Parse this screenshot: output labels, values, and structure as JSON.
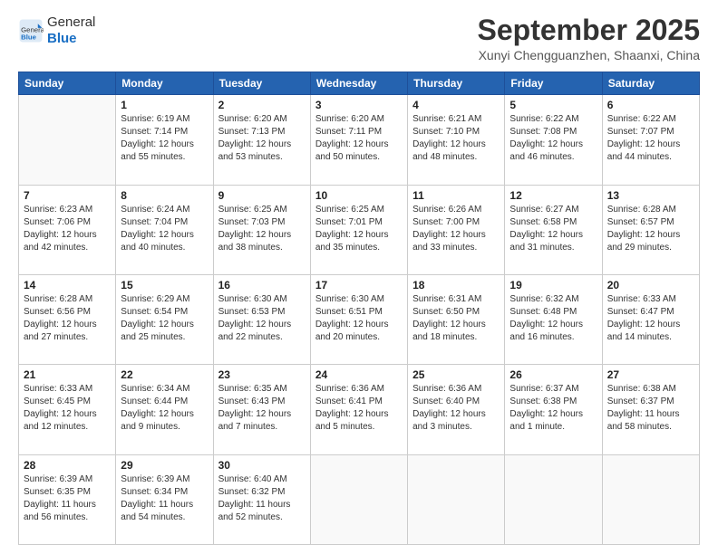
{
  "header": {
    "logo": {
      "general": "General",
      "blue": "Blue"
    },
    "title": "September 2025",
    "subtitle": "Xunyi Chengguanzhen, Shaanxi, China"
  },
  "weekdays": [
    "Sunday",
    "Monday",
    "Tuesday",
    "Wednesday",
    "Thursday",
    "Friday",
    "Saturday"
  ],
  "weeks": [
    [
      {
        "day": "",
        "info": ""
      },
      {
        "day": "1",
        "info": "Sunrise: 6:19 AM\nSunset: 7:14 PM\nDaylight: 12 hours\nand 55 minutes."
      },
      {
        "day": "2",
        "info": "Sunrise: 6:20 AM\nSunset: 7:13 PM\nDaylight: 12 hours\nand 53 minutes."
      },
      {
        "day": "3",
        "info": "Sunrise: 6:20 AM\nSunset: 7:11 PM\nDaylight: 12 hours\nand 50 minutes."
      },
      {
        "day": "4",
        "info": "Sunrise: 6:21 AM\nSunset: 7:10 PM\nDaylight: 12 hours\nand 48 minutes."
      },
      {
        "day": "5",
        "info": "Sunrise: 6:22 AM\nSunset: 7:08 PM\nDaylight: 12 hours\nand 46 minutes."
      },
      {
        "day": "6",
        "info": "Sunrise: 6:22 AM\nSunset: 7:07 PM\nDaylight: 12 hours\nand 44 minutes."
      }
    ],
    [
      {
        "day": "7",
        "info": "Sunrise: 6:23 AM\nSunset: 7:06 PM\nDaylight: 12 hours\nand 42 minutes."
      },
      {
        "day": "8",
        "info": "Sunrise: 6:24 AM\nSunset: 7:04 PM\nDaylight: 12 hours\nand 40 minutes."
      },
      {
        "day": "9",
        "info": "Sunrise: 6:25 AM\nSunset: 7:03 PM\nDaylight: 12 hours\nand 38 minutes."
      },
      {
        "day": "10",
        "info": "Sunrise: 6:25 AM\nSunset: 7:01 PM\nDaylight: 12 hours\nand 35 minutes."
      },
      {
        "day": "11",
        "info": "Sunrise: 6:26 AM\nSunset: 7:00 PM\nDaylight: 12 hours\nand 33 minutes."
      },
      {
        "day": "12",
        "info": "Sunrise: 6:27 AM\nSunset: 6:58 PM\nDaylight: 12 hours\nand 31 minutes."
      },
      {
        "day": "13",
        "info": "Sunrise: 6:28 AM\nSunset: 6:57 PM\nDaylight: 12 hours\nand 29 minutes."
      }
    ],
    [
      {
        "day": "14",
        "info": "Sunrise: 6:28 AM\nSunset: 6:56 PM\nDaylight: 12 hours\nand 27 minutes."
      },
      {
        "day": "15",
        "info": "Sunrise: 6:29 AM\nSunset: 6:54 PM\nDaylight: 12 hours\nand 25 minutes."
      },
      {
        "day": "16",
        "info": "Sunrise: 6:30 AM\nSunset: 6:53 PM\nDaylight: 12 hours\nand 22 minutes."
      },
      {
        "day": "17",
        "info": "Sunrise: 6:30 AM\nSunset: 6:51 PM\nDaylight: 12 hours\nand 20 minutes."
      },
      {
        "day": "18",
        "info": "Sunrise: 6:31 AM\nSunset: 6:50 PM\nDaylight: 12 hours\nand 18 minutes."
      },
      {
        "day": "19",
        "info": "Sunrise: 6:32 AM\nSunset: 6:48 PM\nDaylight: 12 hours\nand 16 minutes."
      },
      {
        "day": "20",
        "info": "Sunrise: 6:33 AM\nSunset: 6:47 PM\nDaylight: 12 hours\nand 14 minutes."
      }
    ],
    [
      {
        "day": "21",
        "info": "Sunrise: 6:33 AM\nSunset: 6:45 PM\nDaylight: 12 hours\nand 12 minutes."
      },
      {
        "day": "22",
        "info": "Sunrise: 6:34 AM\nSunset: 6:44 PM\nDaylight: 12 hours\nand 9 minutes."
      },
      {
        "day": "23",
        "info": "Sunrise: 6:35 AM\nSunset: 6:43 PM\nDaylight: 12 hours\nand 7 minutes."
      },
      {
        "day": "24",
        "info": "Sunrise: 6:36 AM\nSunset: 6:41 PM\nDaylight: 12 hours\nand 5 minutes."
      },
      {
        "day": "25",
        "info": "Sunrise: 6:36 AM\nSunset: 6:40 PM\nDaylight: 12 hours\nand 3 minutes."
      },
      {
        "day": "26",
        "info": "Sunrise: 6:37 AM\nSunset: 6:38 PM\nDaylight: 12 hours\nand 1 minute."
      },
      {
        "day": "27",
        "info": "Sunrise: 6:38 AM\nSunset: 6:37 PM\nDaylight: 11 hours\nand 58 minutes."
      }
    ],
    [
      {
        "day": "28",
        "info": "Sunrise: 6:39 AM\nSunset: 6:35 PM\nDaylight: 11 hours\nand 56 minutes."
      },
      {
        "day": "29",
        "info": "Sunrise: 6:39 AM\nSunset: 6:34 PM\nDaylight: 11 hours\nand 54 minutes."
      },
      {
        "day": "30",
        "info": "Sunrise: 6:40 AM\nSunset: 6:32 PM\nDaylight: 11 hours\nand 52 minutes."
      },
      {
        "day": "",
        "info": ""
      },
      {
        "day": "",
        "info": ""
      },
      {
        "day": "",
        "info": ""
      },
      {
        "day": "",
        "info": ""
      }
    ]
  ]
}
